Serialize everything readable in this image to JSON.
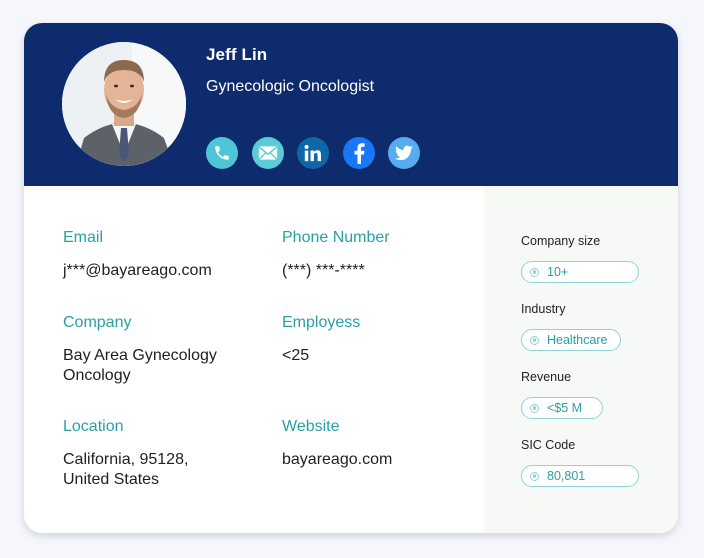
{
  "profile": {
    "name": "Jeff Lin",
    "title": "Gynecologic Oncologist",
    "avatar_alt": "Profile photo of Jeff Lin"
  },
  "socials": [
    {
      "name": "phone",
      "icon": "phone-icon",
      "color": "#4fc6d8"
    },
    {
      "name": "email",
      "icon": "envelope-icon",
      "color": "#5ccbd7"
    },
    {
      "name": "linkedin",
      "icon": "linkedin-icon",
      "color": "#0e67a8"
    },
    {
      "name": "facebook",
      "icon": "facebook-icon",
      "color": "#1877f2"
    },
    {
      "name": "twitter",
      "icon": "twitter-icon",
      "color": "#55acee"
    }
  ],
  "details": {
    "email": {
      "label": "Email",
      "value": "j***@bayareago.com"
    },
    "phone": {
      "label": "Phone Number",
      "value": "(***) ***-****"
    },
    "company": {
      "label": "Company",
      "value_line1": "Bay Area Gynecology",
      "value_line2": "Oncology"
    },
    "employees": {
      "label": "Employess",
      "value": "<25"
    },
    "location": {
      "label": "Location",
      "value_line1": "California, 95128,",
      "value_line2": "United States"
    },
    "website": {
      "label": "Website",
      "value": "bayareago.com"
    }
  },
  "sidebar": {
    "company_size": {
      "label": "Company size",
      "value": "10+"
    },
    "industry": {
      "label": "Industry",
      "value": "Healthcare"
    },
    "revenue": {
      "label": "Revenue",
      "value": "<$5 M"
    },
    "sic_code": {
      "label": "SIC Code",
      "value": "80,801"
    }
  },
  "colors": {
    "header_bg": "#0e2c6d",
    "accent": "#2b9fa7",
    "pill_border": "#8fd3d6",
    "sidebar_bg": "#f7f9f7"
  }
}
